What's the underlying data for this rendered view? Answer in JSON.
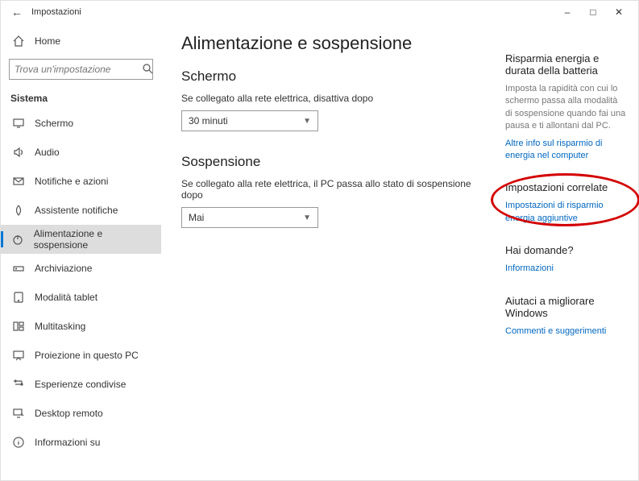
{
  "window": {
    "title": "Impostazioni"
  },
  "sidebar": {
    "home": "Home",
    "search_placeholder": "Trova un'impostazione",
    "section": "Sistema",
    "items": [
      {
        "label": "Schermo"
      },
      {
        "label": "Audio"
      },
      {
        "label": "Notifiche e azioni"
      },
      {
        "label": "Assistente notifiche"
      },
      {
        "label": "Alimentazione e sospensione"
      },
      {
        "label": "Archiviazione"
      },
      {
        "label": "Modalità tablet"
      },
      {
        "label": "Multitasking"
      },
      {
        "label": "Proiezione in questo PC"
      },
      {
        "label": "Esperienze condivise"
      },
      {
        "label": "Desktop remoto"
      },
      {
        "label": "Informazioni su"
      }
    ]
  },
  "main": {
    "title": "Alimentazione e sospensione",
    "screen": {
      "heading": "Schermo",
      "desc": "Se collegato alla rete elettrica, disattiva dopo",
      "value": "30 minuti"
    },
    "sleep": {
      "heading": "Sospensione",
      "desc": "Se collegato alla rete elettrica, il PC passa allo stato di sospensione dopo",
      "value": "Mai"
    }
  },
  "right": {
    "block1": {
      "heading": "Risparmia energia e durata della batteria",
      "text": "Imposta la rapidità con cui lo schermo passa alla modalità di sospensione quando fai una pausa e ti allontani dal PC.",
      "link": "Altre info sul risparmio di energia nel computer"
    },
    "block2": {
      "heading": "Impostazioni correlate",
      "link": "Impostazioni di risparmio energia aggiuntive"
    },
    "block3": {
      "heading": "Hai domande?",
      "link": "Informazioni"
    },
    "block4": {
      "heading": "Aiutaci a migliorare Windows",
      "link": "Commenti e suggerimenti"
    }
  }
}
